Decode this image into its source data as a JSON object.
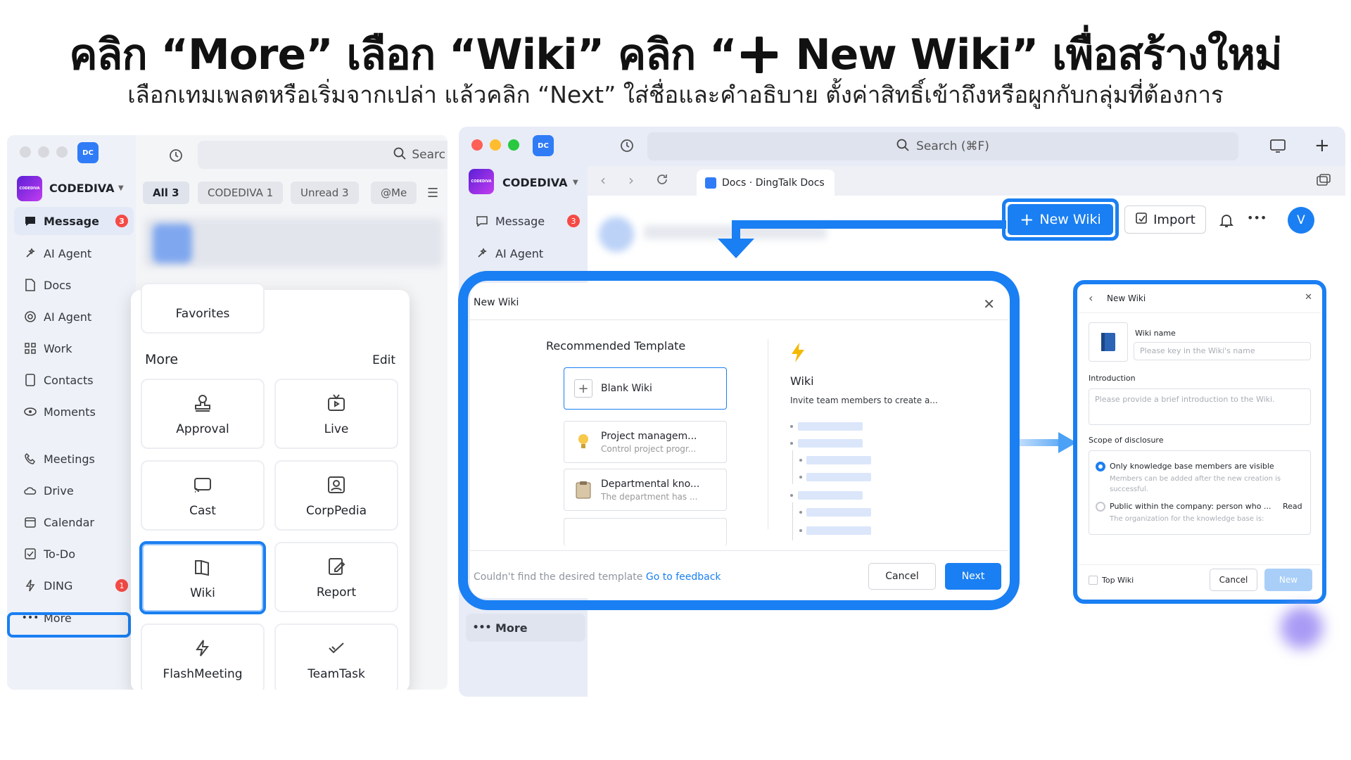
{
  "headline": {
    "part1": "คลิก “More” เลือก “Wiki” คลิก “",
    "part2": " New Wiki” เพื่อสร้างใหม่",
    "subline": "เลือกเทมเพลตหรือเริ่มจากเปล่า แล้วคลิก “Next” ใส่ชื่อและคำอธิบาย ตั้งค่าสิทธิ์เข้าถึงหรือผูกกับกลุ่มที่ต้องการ"
  },
  "app": {
    "badge": "DC",
    "org_name": "CODEDIVA",
    "org_logo_text": "CODEDIVA",
    "search_short": "Searc",
    "search_full": "Search (⌘F)"
  },
  "left": {
    "nav": [
      {
        "label": "Message",
        "badge": "3",
        "icon": "message-icon"
      },
      {
        "label": "AI Agent",
        "badge": "",
        "icon": "sparkle-icon"
      },
      {
        "label": "Docs",
        "badge": "",
        "icon": "docs-icon"
      },
      {
        "label": "AI Agent",
        "badge": "",
        "icon": "agent-icon"
      },
      {
        "label": "Work",
        "badge": "",
        "icon": "grid-icon"
      },
      {
        "label": "Contacts",
        "badge": "",
        "icon": "contacts-icon"
      },
      {
        "label": "Moments",
        "badge": "",
        "icon": "eye-icon"
      },
      {
        "label": "Meetings",
        "badge": "",
        "icon": "phone-icon"
      },
      {
        "label": "Drive",
        "badge": "",
        "icon": "cloud-icon"
      },
      {
        "label": "Calendar",
        "badge": "",
        "icon": "calendar-icon"
      },
      {
        "label": "To-Do",
        "badge": "",
        "icon": "checkbox-icon"
      },
      {
        "label": "DING",
        "badge": "1",
        "icon": "bolt-icon"
      },
      {
        "label": "More",
        "badge": "",
        "icon": "ellipsis-icon"
      }
    ],
    "chips": [
      "All 3",
      "CODEDIVA 1",
      "Unread 3",
      "@Me"
    ],
    "more_popover": {
      "favorites": "Favorites",
      "title": "More",
      "edit": "Edit",
      "tiles": [
        "Approval",
        "Live",
        "Cast",
        "CorpPedia",
        "Wiki",
        "Report",
        "FlashMeeting",
        "TeamTask"
      ]
    }
  },
  "right": {
    "nav": [
      {
        "label": "Message",
        "badge": "3"
      },
      {
        "label": "AI Agent",
        "badge": ""
      }
    ],
    "more_label": "More",
    "tab_label": "Docs · DingTalk Docs",
    "new_wiki_button": "New Wiki",
    "import_button": "Import",
    "avatar_letter": "V",
    "dialog": {
      "title": "New Wiki",
      "recommended": "Recommended Template",
      "templates": [
        {
          "name": "Blank Wiki",
          "desc": ""
        },
        {
          "name": "Project managem...",
          "desc": "Control project progr..."
        },
        {
          "name": "Departmental kno...",
          "desc": "The department has ..."
        }
      ],
      "preview_title": "Wiki",
      "preview_desc": "Invite team members to create a...",
      "footer_text": "Couldn't find the desired template",
      "footer_link": "Go to feedback",
      "cancel": "Cancel",
      "next": "Next"
    },
    "dialog2": {
      "title": "New Wiki",
      "wiki_name_label": "Wiki name",
      "wiki_name_placeholder": "Please key in the Wiki's name",
      "intro_label": "Introduction",
      "intro_placeholder": "Please provide a brief introduction to the Wiki.",
      "scope_label": "Scope of disclosure",
      "option1": "Only knowledge base members are visible",
      "option1_desc_1": "Members can be added after the new creation is",
      "option1_desc_2": "successful.",
      "option2": "Public within the company: person who ...",
      "option2_extra": "Read",
      "option2_desc": "The organization for the knowledge base is:",
      "top_wiki": "Top Wiki",
      "cancel": "Cancel",
      "new": "New"
    }
  },
  "colors": {
    "accent": "#1a7ff2",
    "badge": "#f54a45"
  }
}
